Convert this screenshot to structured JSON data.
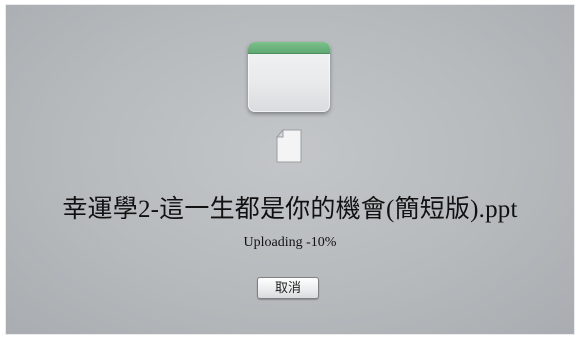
{
  "upload": {
    "file_name": "幸運學2-這一生都是你的機會(簡短版).ppt",
    "status_text": "Uploading -10%",
    "progress_percent": 10,
    "cancel_label": "取消"
  },
  "icons": {
    "window": "app-window-icon",
    "document": "document-icon"
  },
  "colors": {
    "background": "#b8bcbf",
    "window_titlebar": "#6fb57d",
    "text": "#111111"
  }
}
